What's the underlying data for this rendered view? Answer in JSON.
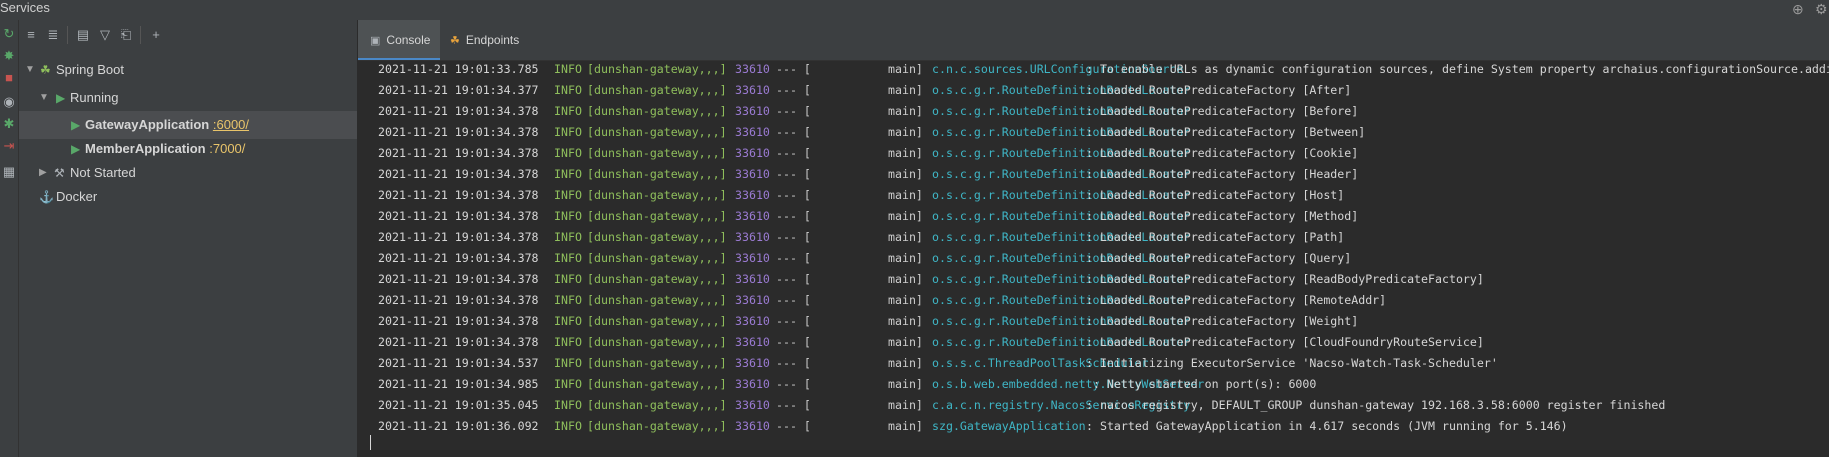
{
  "titlebar": {
    "title": "Services"
  },
  "tree": {
    "spring_boot": "Spring Boot",
    "running": "Running",
    "gateway_app": "GatewayApplication",
    "gateway_port": ":6000/",
    "member_app": "MemberApplication",
    "member_port": ":7000/",
    "not_started": "Not Started",
    "docker": "Docker"
  },
  "tabs": [
    {
      "label": "Console",
      "active": true
    },
    {
      "label": "Endpoints",
      "active": false
    }
  ],
  "console": {
    "lines": [
      {
        "ts": "2021-11-21 19:01:33.785",
        "level": "INFO",
        "app": "[dunshan-gateway,,,]",
        "pid": "33610",
        "sep": "--- [",
        "thread": "main]",
        "logger": "c.n.c.sources.URLConfigurationSource",
        "msg": ": To enable URLs as dynamic configuration sources, define System property archaius.configurationSource.additionalUrls"
      },
      {
        "ts": "2021-11-21 19:01:34.377",
        "level": "INFO",
        "app": "[dunshan-gateway,,,]",
        "pid": "33610",
        "sep": "--- [",
        "thread": "main]",
        "logger": "o.s.c.g.r.RouteDefinitionRouteLocator",
        "msg": ": Loaded RoutePredicateFactory [After]"
      },
      {
        "ts": "2021-11-21 19:01:34.378",
        "level": "INFO",
        "app": "[dunshan-gateway,,,]",
        "pid": "33610",
        "sep": "--- [",
        "thread": "main]",
        "logger": "o.s.c.g.r.RouteDefinitionRouteLocator",
        "msg": ": Loaded RoutePredicateFactory [Before]"
      },
      {
        "ts": "2021-11-21 19:01:34.378",
        "level": "INFO",
        "app": "[dunshan-gateway,,,]",
        "pid": "33610",
        "sep": "--- [",
        "thread": "main]",
        "logger": "o.s.c.g.r.RouteDefinitionRouteLocator",
        "msg": ": Loaded RoutePredicateFactory [Between]"
      },
      {
        "ts": "2021-11-21 19:01:34.378",
        "level": "INFO",
        "app": "[dunshan-gateway,,,]",
        "pid": "33610",
        "sep": "--- [",
        "thread": "main]",
        "logger": "o.s.c.g.r.RouteDefinitionRouteLocator",
        "msg": ": Loaded RoutePredicateFactory [Cookie]"
      },
      {
        "ts": "2021-11-21 19:01:34.378",
        "level": "INFO",
        "app": "[dunshan-gateway,,,]",
        "pid": "33610",
        "sep": "--- [",
        "thread": "main]",
        "logger": "o.s.c.g.r.RouteDefinitionRouteLocator",
        "msg": ": Loaded RoutePredicateFactory [Header]"
      },
      {
        "ts": "2021-11-21 19:01:34.378",
        "level": "INFO",
        "app": "[dunshan-gateway,,,]",
        "pid": "33610",
        "sep": "--- [",
        "thread": "main]",
        "logger": "o.s.c.g.r.RouteDefinitionRouteLocator",
        "msg": ": Loaded RoutePredicateFactory [Host]"
      },
      {
        "ts": "2021-11-21 19:01:34.378",
        "level": "INFO",
        "app": "[dunshan-gateway,,,]",
        "pid": "33610",
        "sep": "--- [",
        "thread": "main]",
        "logger": "o.s.c.g.r.RouteDefinitionRouteLocator",
        "msg": ": Loaded RoutePredicateFactory [Method]"
      },
      {
        "ts": "2021-11-21 19:01:34.378",
        "level": "INFO",
        "app": "[dunshan-gateway,,,]",
        "pid": "33610",
        "sep": "--- [",
        "thread": "main]",
        "logger": "o.s.c.g.r.RouteDefinitionRouteLocator",
        "msg": ": Loaded RoutePredicateFactory [Path]"
      },
      {
        "ts": "2021-11-21 19:01:34.378",
        "level": "INFO",
        "app": "[dunshan-gateway,,,]",
        "pid": "33610",
        "sep": "--- [",
        "thread": "main]",
        "logger": "o.s.c.g.r.RouteDefinitionRouteLocator",
        "msg": ": Loaded RoutePredicateFactory [Query]"
      },
      {
        "ts": "2021-11-21 19:01:34.378",
        "level": "INFO",
        "app": "[dunshan-gateway,,,]",
        "pid": "33610",
        "sep": "--- [",
        "thread": "main]",
        "logger": "o.s.c.g.r.RouteDefinitionRouteLocator",
        "msg": ": Loaded RoutePredicateFactory [ReadBodyPredicateFactory]"
      },
      {
        "ts": "2021-11-21 19:01:34.378",
        "level": "INFO",
        "app": "[dunshan-gateway,,,]",
        "pid": "33610",
        "sep": "--- [",
        "thread": "main]",
        "logger": "o.s.c.g.r.RouteDefinitionRouteLocator",
        "msg": ": Loaded RoutePredicateFactory [RemoteAddr]"
      },
      {
        "ts": "2021-11-21 19:01:34.378",
        "level": "INFO",
        "app": "[dunshan-gateway,,,]",
        "pid": "33610",
        "sep": "--- [",
        "thread": "main]",
        "logger": "o.s.c.g.r.RouteDefinitionRouteLocator",
        "msg": ": Loaded RoutePredicateFactory [Weight]"
      },
      {
        "ts": "2021-11-21 19:01:34.378",
        "level": "INFO",
        "app": "[dunshan-gateway,,,]",
        "pid": "33610",
        "sep": "--- [",
        "thread": "main]",
        "logger": "o.s.c.g.r.RouteDefinitionRouteLocator",
        "msg": ": Loaded RoutePredicateFactory [CloudFoundryRouteService]"
      },
      {
        "ts": "2021-11-21 19:01:34.537",
        "level": "INFO",
        "app": "[dunshan-gateway,,,]",
        "pid": "33610",
        "sep": "--- [",
        "thread": "main]",
        "logger": "o.s.s.c.ThreadPoolTaskScheduler",
        "msg": ": Initializing ExecutorService 'Nacso-Watch-Task-Scheduler'"
      },
      {
        "ts": "2021-11-21 19:01:34.985",
        "level": "INFO",
        "app": "[dunshan-gateway,,,]",
        "pid": "33610",
        "sep": "--- [",
        "thread": "main]",
        "logger": "o.s.b.web.embedded.netty.NettyWebServer",
        "msg": ": Netty started on port(s): 6000"
      },
      {
        "ts": "2021-11-21 19:01:35.045",
        "level": "INFO",
        "app": "[dunshan-gateway,,,]",
        "pid": "33610",
        "sep": "--- [",
        "thread": "main]",
        "logger": "c.a.c.n.registry.NacosServiceRegistry",
        "msg": ": nacos registry, DEFAULT_GROUP dunshan-gateway 192.168.3.58:6000 register finished"
      },
      {
        "ts": "2021-11-21 19:01:36.092",
        "level": "INFO",
        "app": "[dunshan-gateway,,,]",
        "pid": "33610",
        "sep": "--- [",
        "thread": "main]",
        "logger": "szg.GatewayApplication",
        "msg": ": Started GatewayApplication in 4.617 seconds (JVM running for 5.146)"
      }
    ]
  }
}
